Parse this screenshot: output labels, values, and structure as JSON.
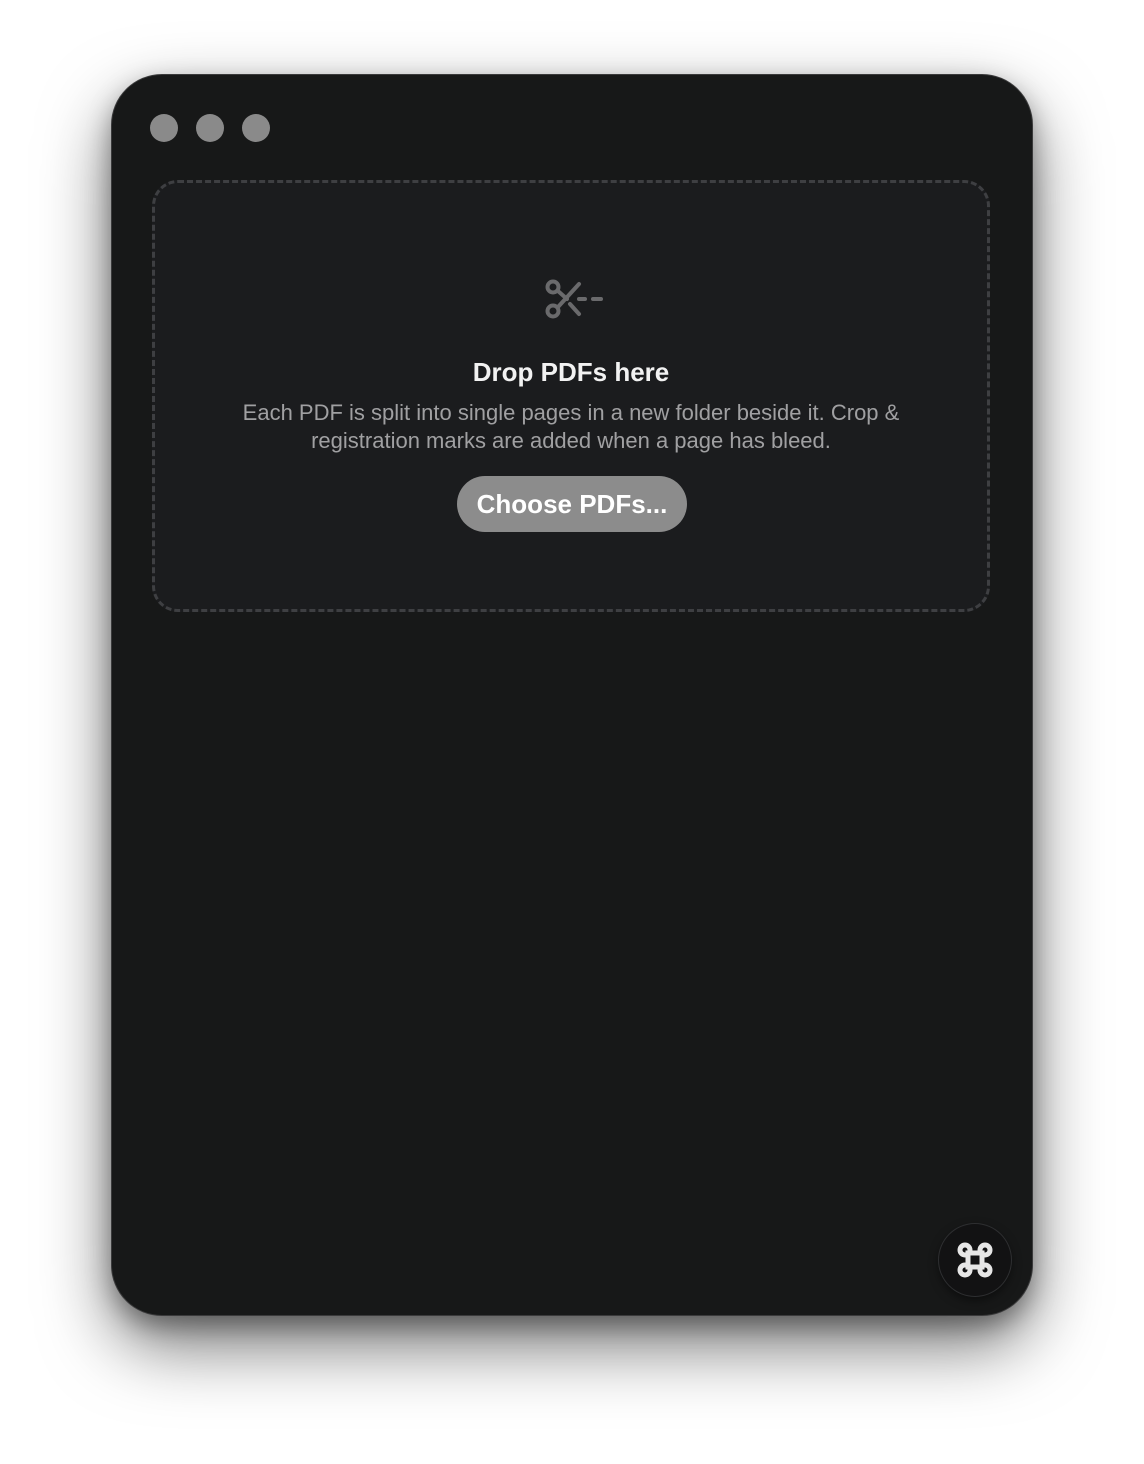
{
  "window": {
    "traffic_lights": [
      "close",
      "minimize",
      "zoom"
    ]
  },
  "dropzone": {
    "icon": "scissors-cut-icon",
    "title": "Drop PDFs here",
    "description": "Each PDF is split into single pages in a new folder beside it. Crop & registration marks are added when a page has bleed.",
    "button_label": "Choose PDFs..."
  },
  "corner_button": {
    "icon": "command-key-icon"
  },
  "colors": {
    "window_bg": "#171818",
    "dropzone_bg": "#1b1c1e",
    "dropzone_border": "#3e3f42",
    "button_bg": "#8c8c8c",
    "traffic_light": "#8a8a8a"
  }
}
